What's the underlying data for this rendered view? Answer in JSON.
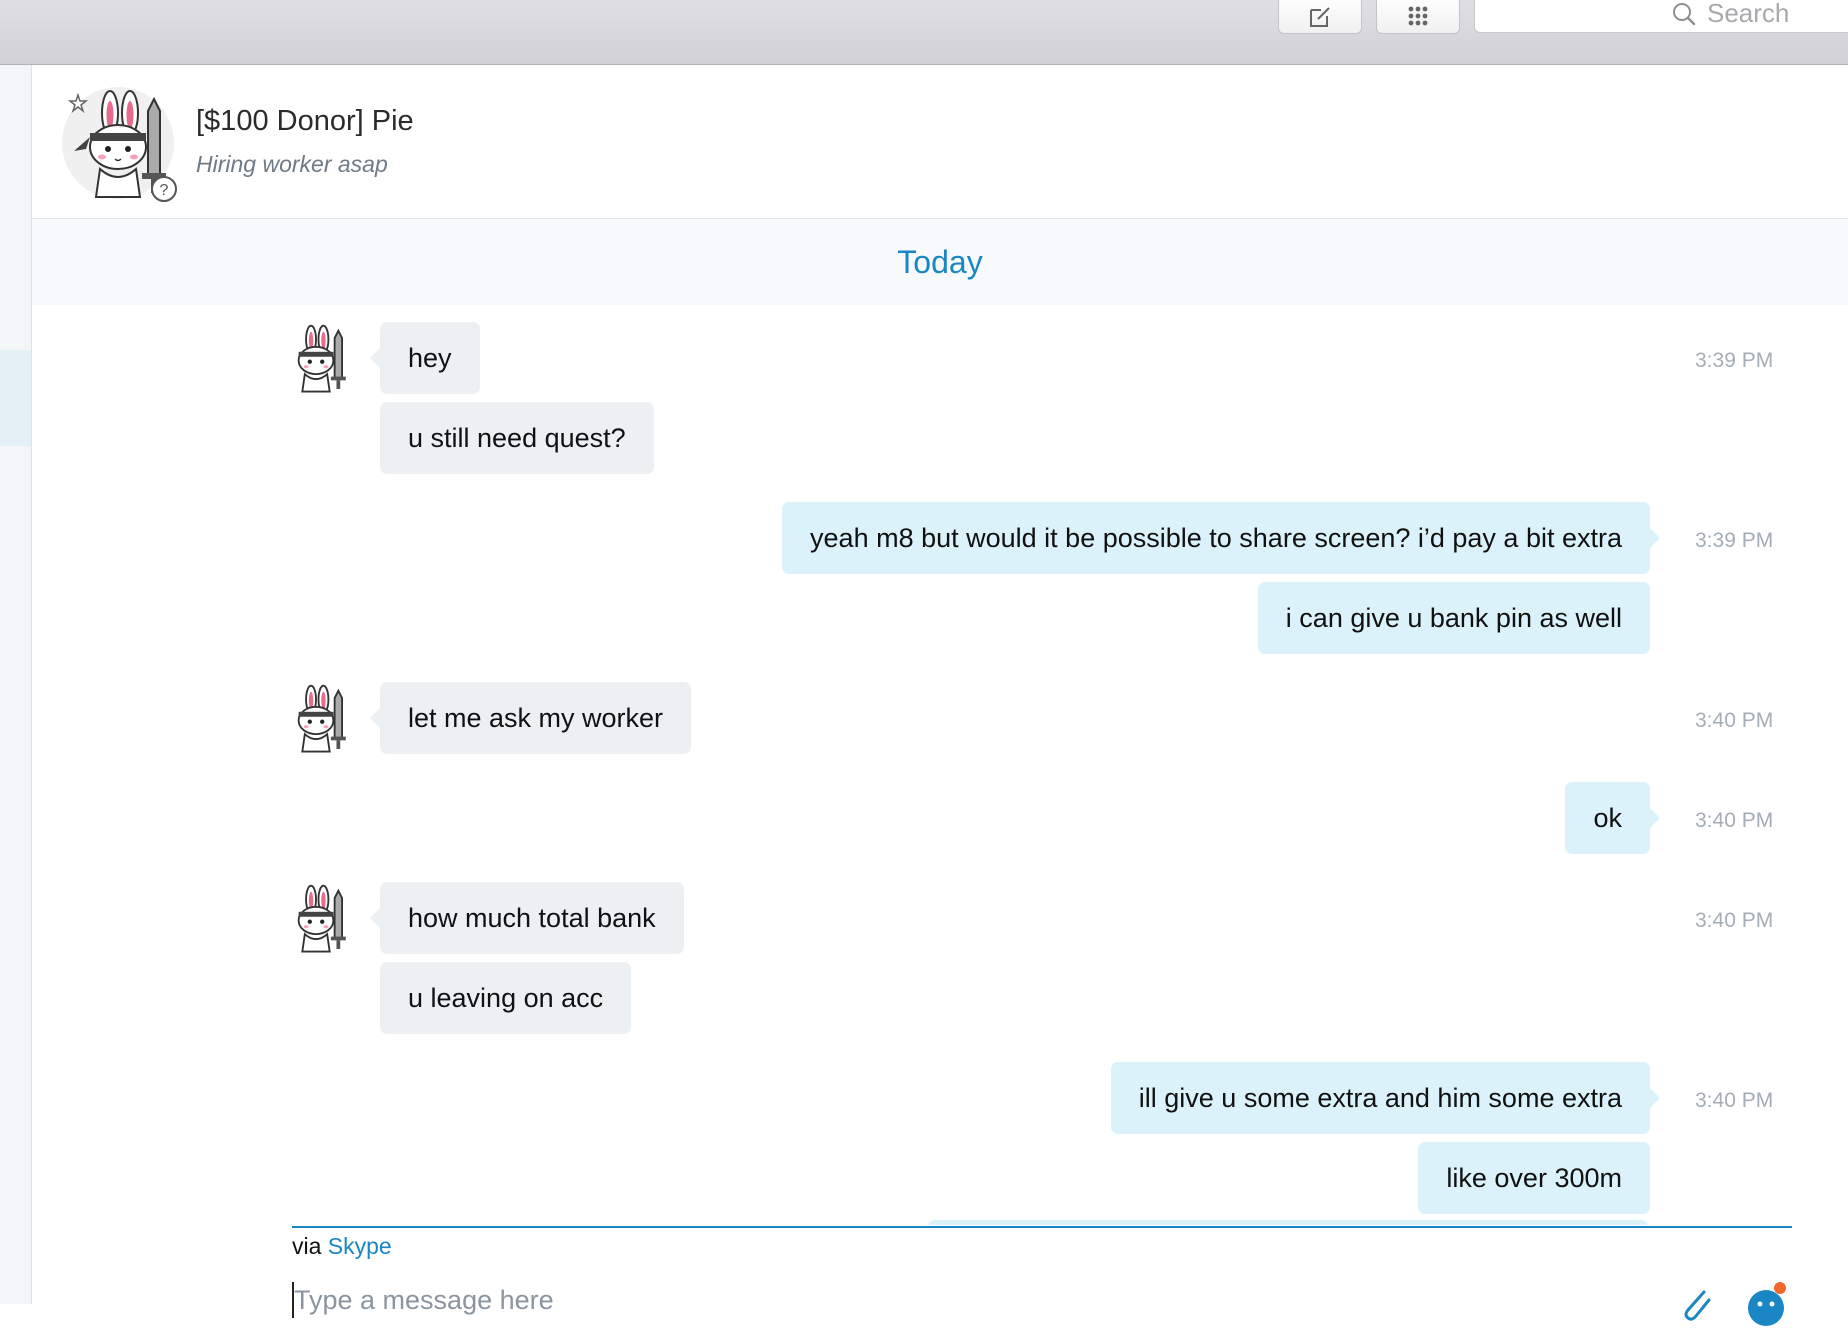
{
  "toolbar": {
    "compose_icon": "compose-icon",
    "dialpad_icon": "dialpad-icon",
    "search_placeholder": "Search"
  },
  "conversation": {
    "contact_name": "[$100 Donor] Pie",
    "contact_status": "Hiring worker asap"
  },
  "day_divider": "Today",
  "messages": [
    {
      "id": "m1",
      "direction": "incoming",
      "text": "hey",
      "time": "3:39 PM"
    },
    {
      "id": "m2",
      "direction": "incoming",
      "text": "u still need quest?",
      "time": ""
    },
    {
      "id": "m3",
      "direction": "outgoing",
      "text": "yeah m8 but would it be possible to share screen? i’d pay a bit extra",
      "time": "3:39 PM"
    },
    {
      "id": "m4",
      "direction": "outgoing",
      "text": "i can give u bank pin as well",
      "time": ""
    },
    {
      "id": "m5",
      "direction": "incoming",
      "text": "let me ask my worker",
      "time": "3:40 PM"
    },
    {
      "id": "m6",
      "direction": "outgoing",
      "text": "ok",
      "time": "3:40 PM"
    },
    {
      "id": "m7",
      "direction": "incoming",
      "text": "how much total bank",
      "time": "3:40 PM"
    },
    {
      "id": "m8",
      "direction": "incoming",
      "text": "u leaving on acc",
      "time": ""
    },
    {
      "id": "m9",
      "direction": "outgoing",
      "text": "ill give u some extra and him some extra",
      "time": "3:40 PM"
    },
    {
      "id": "m10",
      "direction": "outgoing",
      "text": "like over 300m",
      "time": ""
    }
  ],
  "composer": {
    "via_label": "via",
    "via_service": "Skype",
    "placeholder": "Type a message here"
  },
  "colors": {
    "accent": "#1b86c4",
    "incoming_bubble": "#edf0f3",
    "outgoing_bubble": "#dbf2fa",
    "timestamp": "#a4adb7"
  }
}
